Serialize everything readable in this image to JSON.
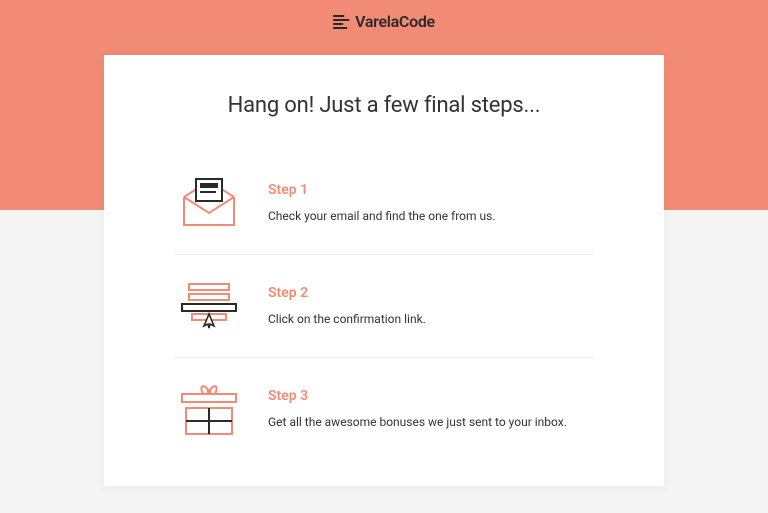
{
  "brand": {
    "name": "VarelaCode"
  },
  "heading": "Hang on! Just a few final steps...",
  "steps": [
    {
      "label": "Step 1",
      "desc": "Check your email and find the one from us."
    },
    {
      "label": "Step 2",
      "desc": "Click on the confirmation link."
    },
    {
      "label": "Step 3",
      "desc": "Get all the awesome bonuses we just sent to your inbox."
    }
  ],
  "colors": {
    "accent": "#f28b75",
    "dark": "#2a2a2a"
  }
}
